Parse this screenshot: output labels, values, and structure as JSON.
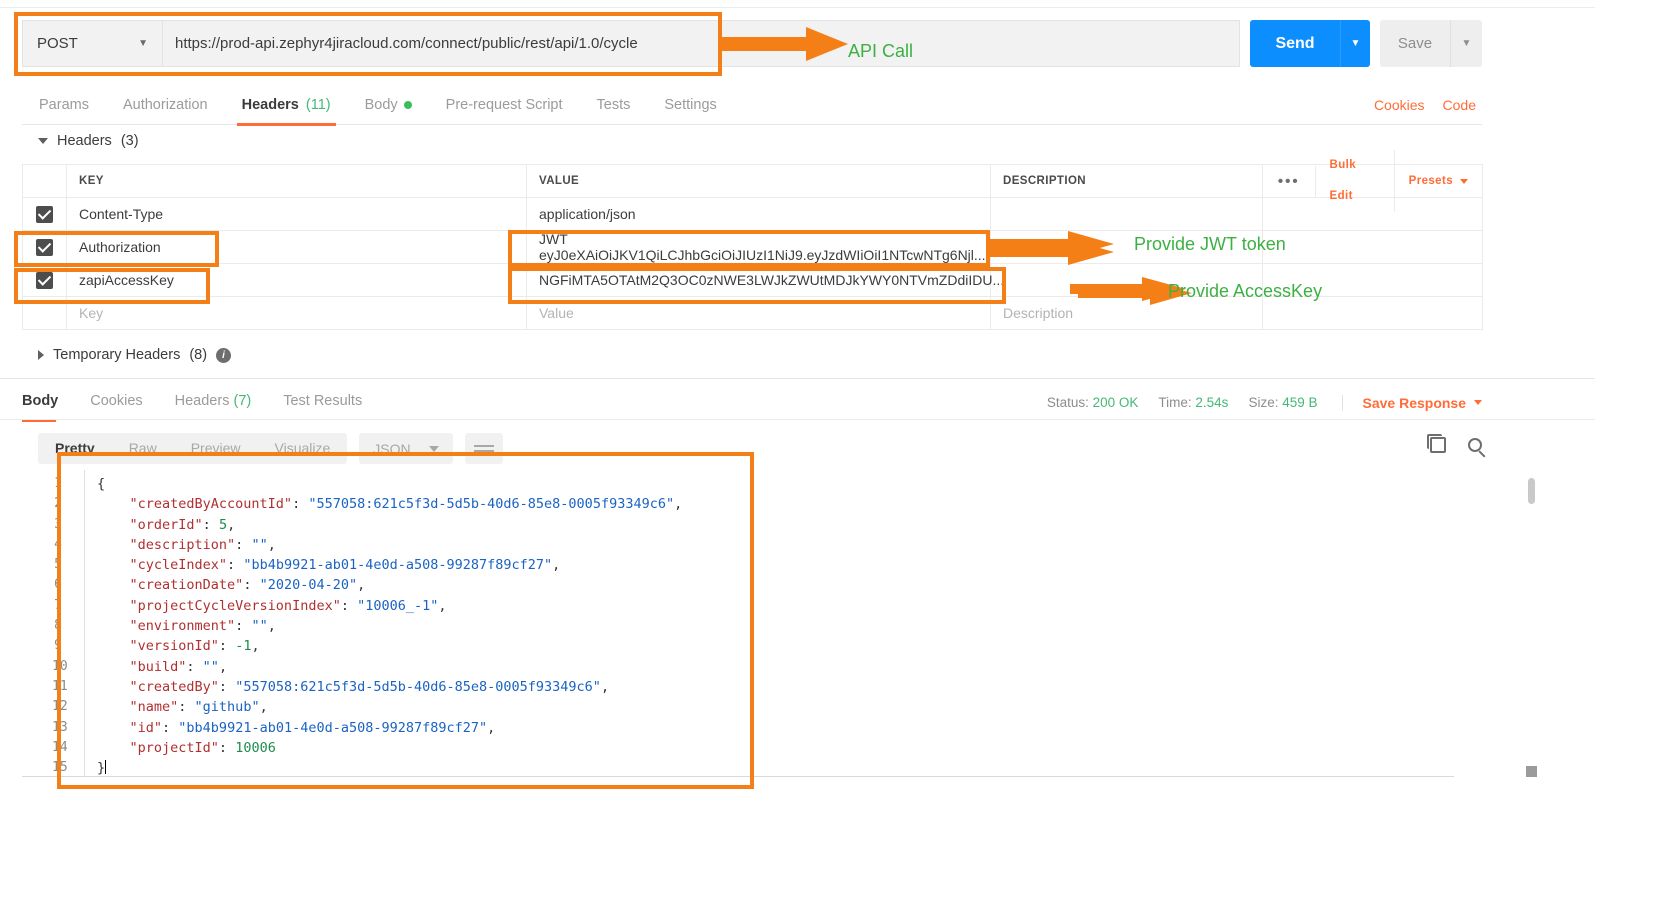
{
  "request": {
    "method": "POST",
    "method_caret": "▼",
    "url": "https://prod-api.zephyr4jiracloud.com/connect/public/rest/api/1.0/cycle",
    "send_label": "Send",
    "send_caret": "▼",
    "save_label": "Save",
    "save_caret": "▼"
  },
  "request_tabs": [
    {
      "label": "Params",
      "count": "",
      "active": false
    },
    {
      "label": "Authorization",
      "count": "",
      "active": false
    },
    {
      "label": "Headers",
      "count": "(11)",
      "active": true
    },
    {
      "label": "Body",
      "count": "",
      "active": false,
      "dot": true
    },
    {
      "label": "Pre-request Script",
      "count": "",
      "active": false
    },
    {
      "label": "Tests",
      "count": "",
      "active": false
    },
    {
      "label": "Settings",
      "count": "",
      "active": false
    }
  ],
  "request_tabs_right": [
    {
      "label": "Cookies"
    },
    {
      "label": "Code"
    }
  ],
  "headers_section": {
    "title": "Headers",
    "count": "(3)",
    "columns": {
      "key": "KEY",
      "value": "VALUE",
      "description": "DESCRIPTION"
    },
    "tools": {
      "dots": "•••",
      "bulk_edit": "Bulk Edit",
      "presets": "Presets"
    },
    "rows": [
      {
        "checked": true,
        "key": "Content-Type",
        "value": "application/json",
        "description": ""
      },
      {
        "checked": true,
        "key": "Authorization",
        "value": "JWT eyJ0eXAiOiJKV1QiLCJhbGciOiJIUzI1NiJ9.eyJzdWIiOiI1NTcwNTg6Njl...",
        "description": ""
      },
      {
        "checked": true,
        "key": "zapiAccessKey",
        "value": "NGFiMTA5OTAtM2Q3OC0zNWE3LWJkZWUtMDJkYWY0NTVmZDdiIDU...",
        "description": ""
      }
    ],
    "placeholder_row": {
      "key": "Key",
      "value": "Value",
      "description": "Description"
    }
  },
  "temporary_headers": {
    "title": "Temporary Headers",
    "count": "(8)"
  },
  "response_tabs": [
    {
      "label": "Body",
      "count": "",
      "active": true
    },
    {
      "label": "Cookies",
      "count": "",
      "active": false
    },
    {
      "label": "Headers",
      "count": "(7)",
      "active": false
    },
    {
      "label": "Test Results",
      "count": "",
      "active": false
    }
  ],
  "response_status": {
    "status_label": "Status:",
    "status_value": "200 OK",
    "time_label": "Time:",
    "time_value": "2.54s",
    "size_label": "Size:",
    "size_value": "459 B",
    "save_response": "Save Response",
    "save_response_caret": "▼"
  },
  "format_bar": {
    "modes": [
      {
        "label": "Pretty",
        "active": true
      },
      {
        "label": "Raw",
        "active": false
      },
      {
        "label": "Preview",
        "active": false
      },
      {
        "label": "Visualize",
        "active": false
      }
    ],
    "language": "JSON",
    "language_caret": "▼"
  },
  "response_body": {
    "lines": [
      {
        "no": "1",
        "tokens": [
          {
            "t": "p",
            "v": "{"
          }
        ]
      },
      {
        "no": "2",
        "tokens": [
          {
            "t": "k",
            "v": "    \"createdByAccountId\""
          },
          {
            "t": "p",
            "v": ": "
          },
          {
            "t": "s",
            "v": "\"557058:621c5f3d-5d5b-40d6-85e8-0005f93349c6\""
          },
          {
            "t": "p",
            "v": ","
          }
        ]
      },
      {
        "no": "3",
        "tokens": [
          {
            "t": "k",
            "v": "    \"orderId\""
          },
          {
            "t": "p",
            "v": ": "
          },
          {
            "t": "n",
            "v": "5"
          },
          {
            "t": "p",
            "v": ","
          }
        ]
      },
      {
        "no": "4",
        "tokens": [
          {
            "t": "k",
            "v": "    \"description\""
          },
          {
            "t": "p",
            "v": ": "
          },
          {
            "t": "s",
            "v": "\"\""
          },
          {
            "t": "p",
            "v": ","
          }
        ]
      },
      {
        "no": "5",
        "tokens": [
          {
            "t": "k",
            "v": "    \"cycleIndex\""
          },
          {
            "t": "p",
            "v": ": "
          },
          {
            "t": "s",
            "v": "\"bb4b9921-ab01-4e0d-a508-99287f89cf27\""
          },
          {
            "t": "p",
            "v": ","
          }
        ]
      },
      {
        "no": "6",
        "tokens": [
          {
            "t": "k",
            "v": "    \"creationDate\""
          },
          {
            "t": "p",
            "v": ": "
          },
          {
            "t": "s",
            "v": "\"2020-04-20\""
          },
          {
            "t": "p",
            "v": ","
          }
        ]
      },
      {
        "no": "7",
        "tokens": [
          {
            "t": "k",
            "v": "    \"projectCycleVersionIndex\""
          },
          {
            "t": "p",
            "v": ": "
          },
          {
            "t": "s",
            "v": "\"10006_-1\""
          },
          {
            "t": "p",
            "v": ","
          }
        ]
      },
      {
        "no": "8",
        "tokens": [
          {
            "t": "k",
            "v": "    \"environment\""
          },
          {
            "t": "p",
            "v": ": "
          },
          {
            "t": "s",
            "v": "\"\""
          },
          {
            "t": "p",
            "v": ","
          }
        ]
      },
      {
        "no": "9",
        "tokens": [
          {
            "t": "k",
            "v": "    \"versionId\""
          },
          {
            "t": "p",
            "v": ": "
          },
          {
            "t": "n",
            "v": "-1"
          },
          {
            "t": "p",
            "v": ","
          }
        ]
      },
      {
        "no": "10",
        "tokens": [
          {
            "t": "k",
            "v": "    \"build\""
          },
          {
            "t": "p",
            "v": ": "
          },
          {
            "t": "s",
            "v": "\"\""
          },
          {
            "t": "p",
            "v": ","
          }
        ]
      },
      {
        "no": "11",
        "tokens": [
          {
            "t": "k",
            "v": "    \"createdBy\""
          },
          {
            "t": "p",
            "v": ": "
          },
          {
            "t": "s",
            "v": "\"557058:621c5f3d-5d5b-40d6-85e8-0005f93349c6\""
          },
          {
            "t": "p",
            "v": ","
          }
        ]
      },
      {
        "no": "12",
        "tokens": [
          {
            "t": "k",
            "v": "    \"name\""
          },
          {
            "t": "p",
            "v": ": "
          },
          {
            "t": "s",
            "v": "\"github\""
          },
          {
            "t": "p",
            "v": ","
          }
        ]
      },
      {
        "no": "13",
        "tokens": [
          {
            "t": "k",
            "v": "    \"id\""
          },
          {
            "t": "p",
            "v": ": "
          },
          {
            "t": "s",
            "v": "\"bb4b9921-ab01-4e0d-a508-99287f89cf27\""
          },
          {
            "t": "p",
            "v": ","
          }
        ]
      },
      {
        "no": "14",
        "tokens": [
          {
            "t": "k",
            "v": "    \"projectId\""
          },
          {
            "t": "p",
            "v": ": "
          },
          {
            "t": "n",
            "v": "10006"
          }
        ]
      },
      {
        "no": "15",
        "tokens": [
          {
            "t": "p",
            "v": "}"
          }
        ]
      }
    ]
  },
  "annotations": {
    "accent_box_color": "#f57f17",
    "text_color": "#3cb043",
    "items": [
      {
        "label": "API Call"
      },
      {
        "label": "Provide JWT token"
      },
      {
        "label": "Provide AccessKey"
      }
    ]
  }
}
